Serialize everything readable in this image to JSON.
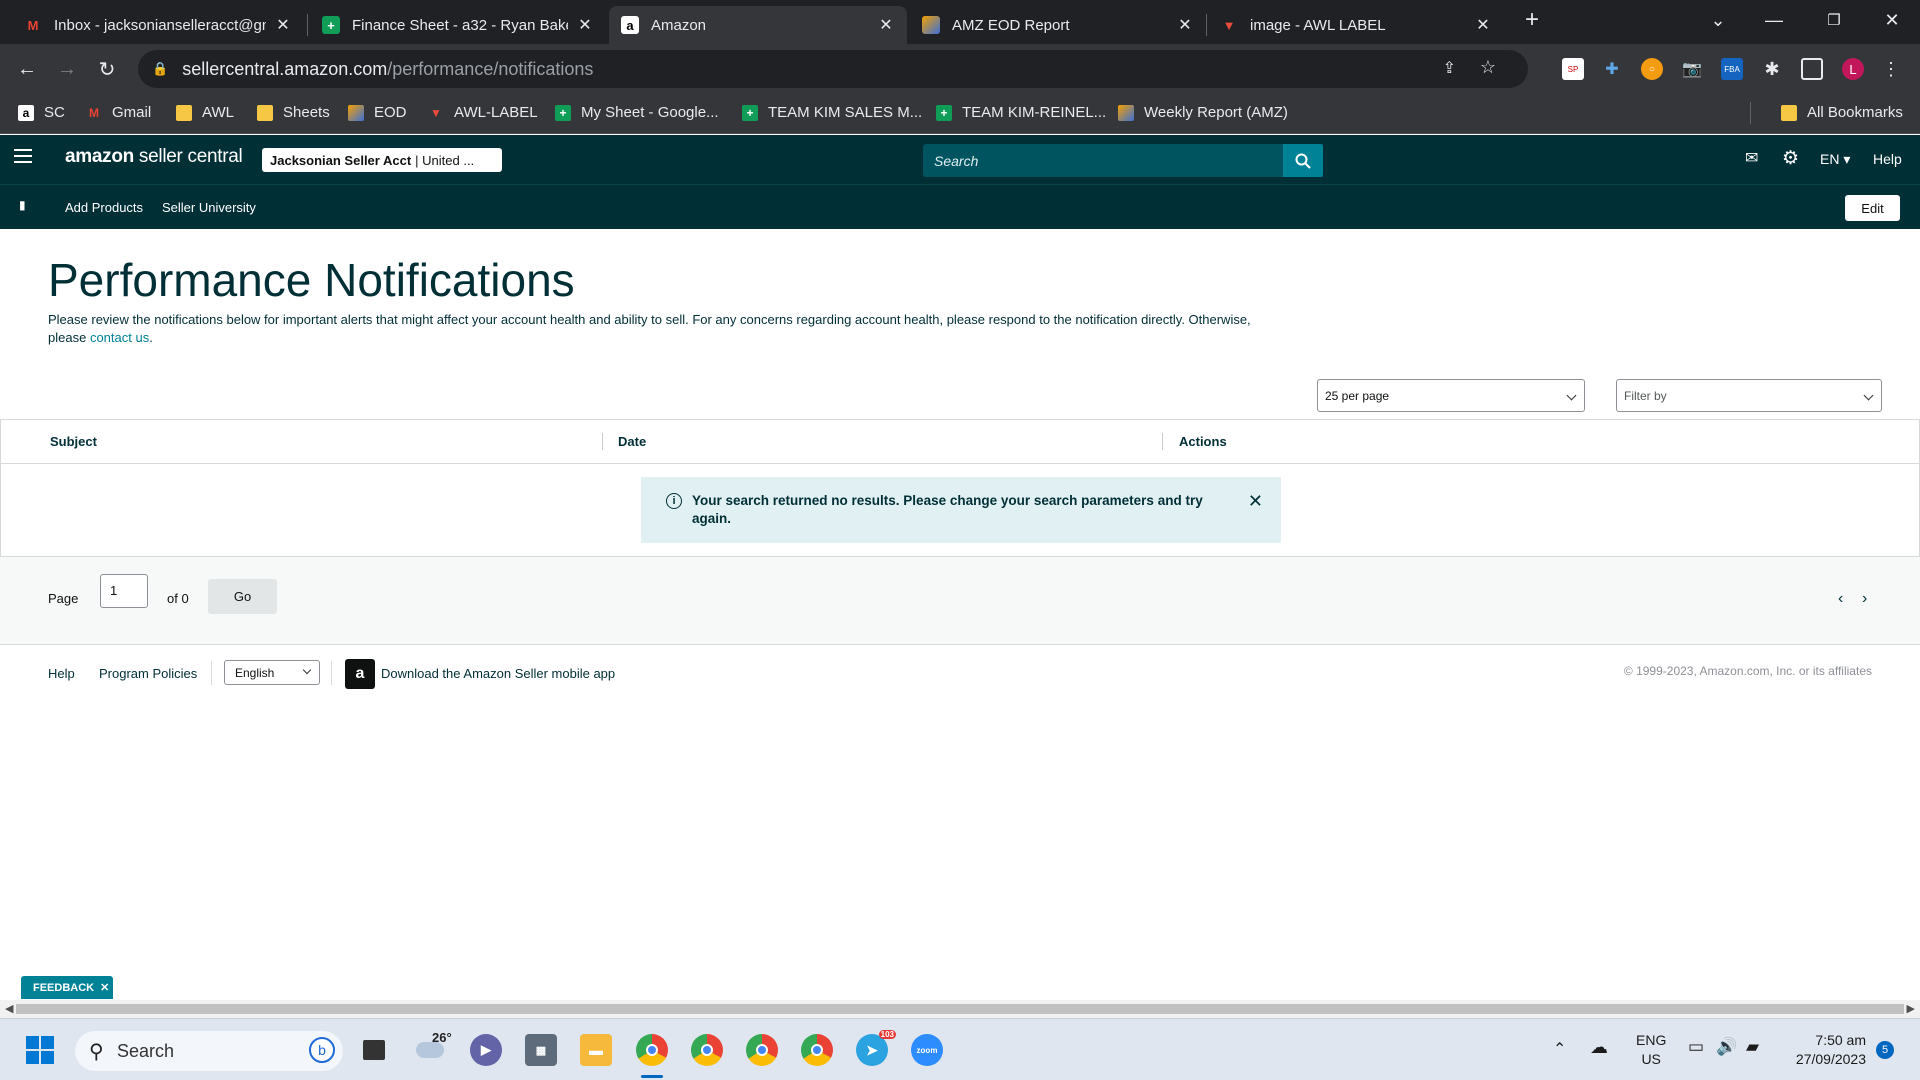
{
  "browser": {
    "tabs": [
      {
        "title": "Inbox - jacksonianselleracct@gm",
        "icon": "gmail-icon",
        "color": "#ea4335"
      },
      {
        "title": "Finance Sheet - a32 - Ryan Bake",
        "icon": "sheets-icon",
        "color": "#0f9d58"
      },
      {
        "title": "Amazon",
        "icon": "amazon-icon",
        "color": "#ffffff"
      },
      {
        "title": "AMZ EOD Report",
        "icon": "report-icon",
        "color": "#f4a000"
      },
      {
        "title": "image - AWL LABEL",
        "icon": "awl-icon",
        "color": "#c0392b"
      }
    ],
    "new_tab_glyph": "+",
    "url_host": "sellercentral.amazon.com",
    "url_path": "/performance/notifications",
    "profile_initial": "L",
    "bookmarks": [
      {
        "label": "SC",
        "icon": "amazon-icon"
      },
      {
        "label": "Gmail",
        "icon": "gmail-icon"
      },
      {
        "label": "AWL",
        "icon": "folder-icon"
      },
      {
        "label": "Sheets",
        "icon": "folder-icon"
      },
      {
        "label": "EOD",
        "icon": "report-icon"
      },
      {
        "label": "AWL-LABEL",
        "icon": "awl-icon"
      },
      {
        "label": "My Sheet - Google...",
        "icon": "sheets-icon"
      },
      {
        "label": "TEAM KIM SALES M...",
        "icon": "sheets-icon"
      },
      {
        "label": "TEAM KIM-REINEL...",
        "icon": "sheets-icon"
      },
      {
        "label": "Weekly Report (AMZ)",
        "icon": "report-icon"
      }
    ],
    "all_bookmarks": "All Bookmarks"
  },
  "header": {
    "logo_bold": "amazon",
    "logo_rest": " seller central",
    "account_name": "Jacksonian Seller Acct",
    "account_region": "| United ...",
    "search_placeholder": "Search",
    "language": "EN",
    "help": "Help"
  },
  "subnav": {
    "items": [
      "Add Products",
      "Seller University"
    ],
    "edit": "Edit"
  },
  "main": {
    "title": "Performance Notifications",
    "description": "Please review the notifications below for important alerts that might affect your account health and ability to sell. For any concerns regarding account health, please respond to the notification directly. Otherwise, please",
    "contact_link": "contact us",
    "description_end": ".",
    "per_page": "25 per page",
    "filter": "Filter by",
    "columns": [
      "Subject",
      "Date",
      "Actions"
    ],
    "alert": "Your search returned no results. Please change your search parameters and try again.",
    "pager": {
      "page_label": "Page",
      "page_value": "1",
      "of_label": "of 0",
      "go": "Go"
    }
  },
  "footer": {
    "help": "Help",
    "policies": "Program Policies",
    "language": "English",
    "app_link": "Download the Amazon Seller mobile app",
    "copyright": "© 1999-2023, Amazon.com, Inc. or its affiliates"
  },
  "feedback": "FEEDBACK",
  "taskbar": {
    "search": "Search",
    "weather": "26°",
    "lang_top": "ENG",
    "lang_bottom": "US",
    "time": "7:50 am",
    "date": "27/09/2023",
    "notification_count": "5",
    "telegram_badge": "103"
  }
}
